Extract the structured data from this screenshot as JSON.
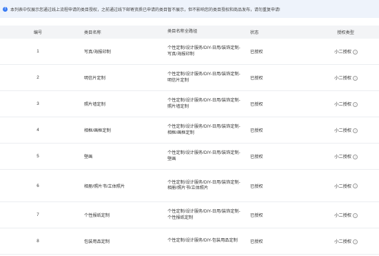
{
  "notice": "本列表中仅展示您通过线上流程申请的类目授权，之前通过线下邮寄资质已申请的类目暂不展示，但不影响您的类目授权和商品发布，请勿重复申请!",
  "table": {
    "headers": [
      "编号",
      "类目名称",
      "类目名称全路径",
      "状态",
      "授权类型"
    ],
    "rows": [
      {
        "no": "1",
        "name": "写真/海报印制",
        "path": "个性定制/设计服务/DIY-日用/装饰定制-写真/海报印制",
        "status": "已授权",
        "type": "小二授权"
      },
      {
        "no": "2",
        "name": "明信片定制",
        "path": "个性定制/设计服务/DIY-日用/装饰定制-明信片定制",
        "status": "已授权",
        "type": "小二授权"
      },
      {
        "no": "3",
        "name": "照片墙定制",
        "path": "个性定制/设计服务/DIY-日用/装饰定制-照片墙定制",
        "status": "已授权",
        "type": "小二授权"
      },
      {
        "no": "4",
        "name": "相框/画框定制",
        "path": "个性定制/设计服务/DIY-日用/装饰定制-相框/画框定制",
        "status": "已授权",
        "type": "小二授权"
      },
      {
        "no": "5",
        "name": "壁画",
        "path": "个性定制/设计服务/DIY-日用/装饰定制-壁画",
        "status": "已授权",
        "type": "小二授权"
      },
      {
        "no": "6",
        "name": "相册/照片书/立体照片",
        "path": "个性定制/设计服务/DIY-日用/装饰定制-相册/照片书/立体照片",
        "status": "已授权",
        "type": "小二授权"
      },
      {
        "no": "7",
        "name": "个性报纸定制",
        "path": "个性定制/设计服务/DIY-日用/装饰定制-个性报纸定制",
        "status": "已授权",
        "type": "小二授权"
      },
      {
        "no": "8",
        "name": "包装用品定制",
        "path": "个性定制/设计服务/DIY-包装用品定制",
        "status": "已授权",
        "type": "小二授权"
      }
    ]
  }
}
